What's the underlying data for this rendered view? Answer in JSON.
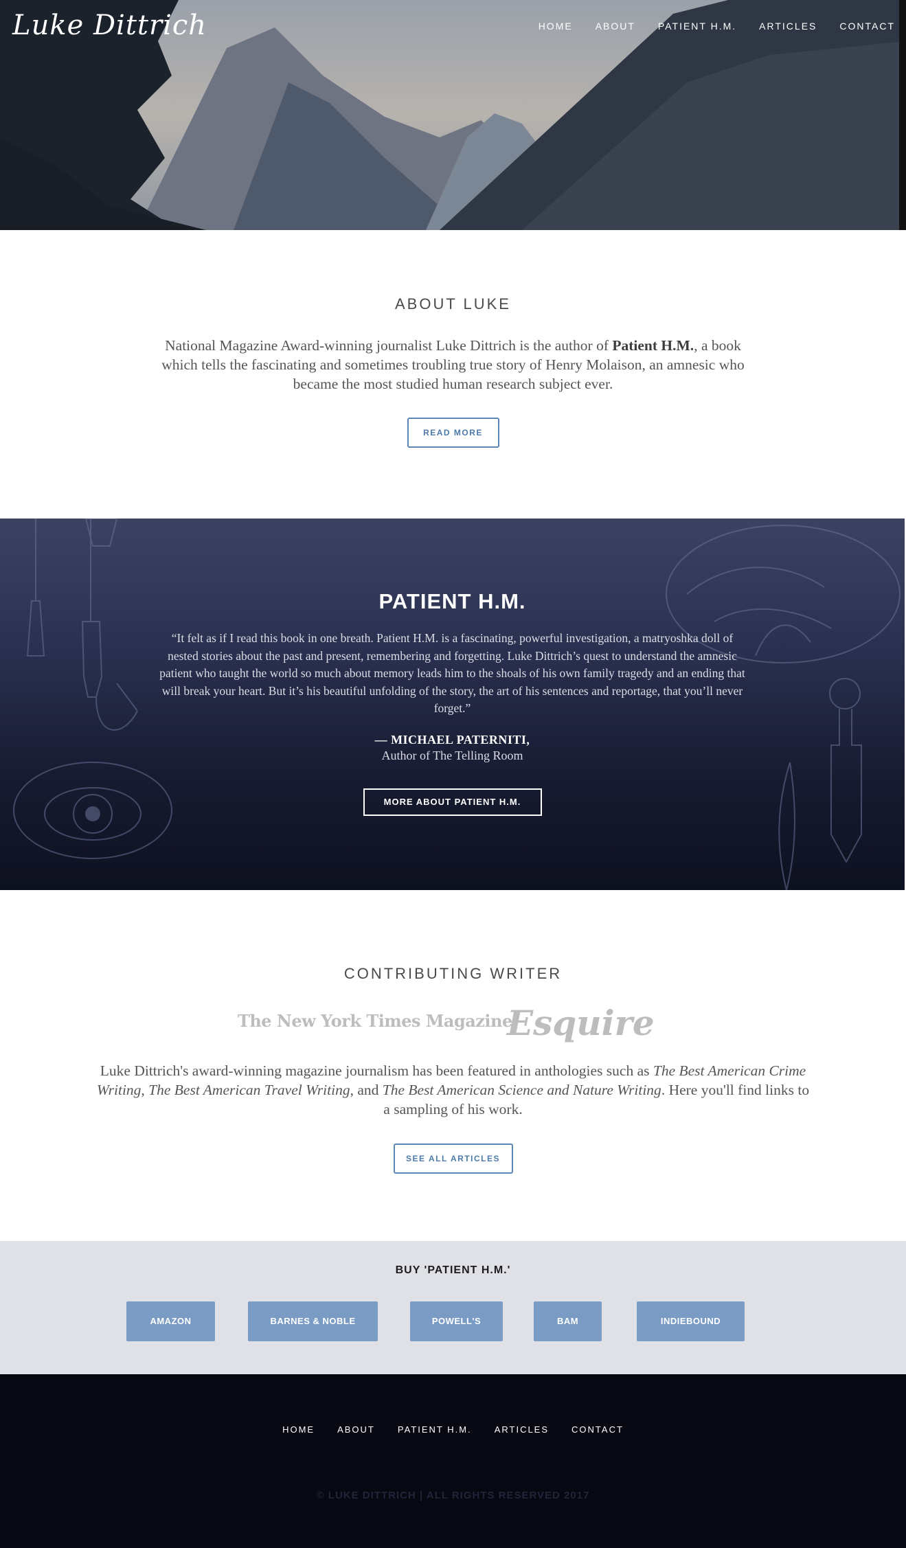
{
  "header": {
    "logo": "Luke Dittrich",
    "nav": [
      "HOME",
      "ABOUT",
      "PATIENT H.M.",
      "ARTICLES",
      "CONTACT"
    ]
  },
  "about": {
    "heading": "ABOUT LUKE",
    "text_before": "National Magazine Award-winning journalist Luke Dittrich is the author of ",
    "text_bold": "Patient H.M.",
    "text_after": ", a book which tells the fascinating and sometimes troubling true story of Henry Molaison, an amnesic who became the most studied human research subject ever.",
    "button": "READ MORE"
  },
  "patient": {
    "title": "PATIENT H.M.",
    "quote": "“It felt as if I read this book in one breath. Patient H.M. is a fascinating, powerful investigation, a matryoshka doll of nested stories about the past and present, remembering and forgetting. Luke Dittrich’s quest to understand the amnesic patient who taught the world so much about memory leads him to the shoals of his own family tragedy and an ending that will break your heart. But it’s his beautiful unfolding of the story, the art of his sentences and reportage, that you’ll never forget.”",
    "author": "— MICHAEL PATERNITI,",
    "author_role": "Author of The Telling Room",
    "button": "MORE ABOUT PATIENT H.M."
  },
  "contributing": {
    "heading": "CONTRIBUTING WRITER",
    "publications": [
      "The New York Times Magazine",
      "Esquire"
    ],
    "text_1": "Luke Dittrich's award-winning magazine journalism has been featured in anthologies such as ",
    "title_1": "The Best American Crime Writing",
    "text_2": ", ",
    "title_2": "The Best American Travel Writing",
    "text_3": ", and ",
    "title_3": "The Best American Science and Nature Writing",
    "text_4": ". Here you'll find links to a sampling of his work.",
    "button": "SEE ALL ARTICLES"
  },
  "buy": {
    "title": "BUY 'PATIENT H.M.'",
    "retailers": [
      "AMAZON",
      "BARNES & NOBLE",
      "POWELL'S",
      "BAM",
      "INDIEBOUND"
    ]
  },
  "footer": {
    "nav": [
      "HOME",
      "ABOUT",
      "PATIENT H.M.",
      "ARTICLES",
      "CONTACT"
    ],
    "copyright": "© LUKE DITTRICH | ALL RIGHTS RESERVED 2017"
  },
  "colors": {
    "accent": "#5a86b5",
    "buy_button": "#7a9bc3",
    "buy_background": "#dfe1e6",
    "footer_background": "#070812",
    "patient_background": "#1f2440"
  }
}
